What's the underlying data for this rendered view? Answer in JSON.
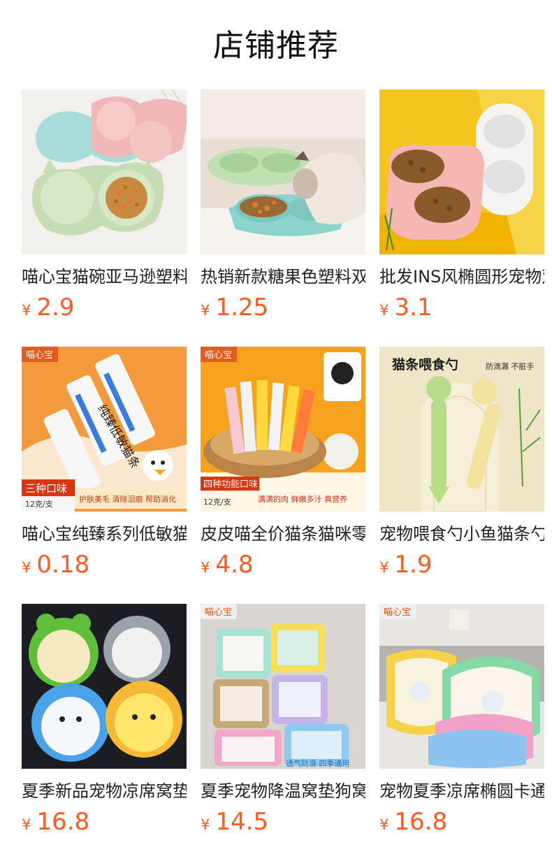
{
  "page": {
    "title": "店铺推荐"
  },
  "currency_symbol": "¥",
  "colors": {
    "price": "#ff5a1f",
    "text": "#222222"
  },
  "products": [
    {
      "name": "喵心宝猫碗亚马逊塑料双碗",
      "price": "2.9",
      "image": "cat-bowl-pastel-photo"
    },
    {
      "name": "热销新款糖果色塑料双碗",
      "price": "1.25",
      "image": "cat-eating-bowl-photo"
    },
    {
      "name": "批发INS风椭圆形宠物双碗",
      "price": "3.1",
      "image": "oval-double-bowl-photo"
    },
    {
      "name": "喵心宝纯臻系列低敏猫条",
      "price": "0.18",
      "image": "cat-treat-sticks-photo",
      "image_text": {
        "brand": "喵心宝",
        "product": "纯臻低敏猫条",
        "badge": "三种口味",
        "spec": "12克/支",
        "tagline": "护肤美毛 清除泪痕 帮助消化"
      }
    },
    {
      "name": "皮皮喵全价猫条猫咪零食",
      "price": "4.8",
      "image": "cat-treat-basket-photo",
      "image_text": {
        "brand": "喵心宝",
        "badge": "四种功能口味",
        "spec": "12克/支",
        "tagline": "满满的肉 鲜嫩多汁 真营养"
      }
    },
    {
      "name": "宠物喂食勺小鱼猫条勺",
      "price": "1.9",
      "image": "feeding-spoon-photo",
      "image_text": {
        "headline": "猫条喂食勺",
        "note": "防滴漏 不脏手"
      }
    },
    {
      "name": "夏季新品宠物凉席窝垫",
      "price": "16.8",
      "image": "animal-cooling-mats-photo"
    },
    {
      "name": "夏季宠物降温窝垫狗窝",
      "price": "14.5",
      "image": "square-cooling-beds-photo",
      "image_text": {
        "brand": "喵心宝",
        "tagline": "透气防滑 四季通用"
      }
    },
    {
      "name": "宠物夏季凉席椭圆卡通窝",
      "price": "16.8",
      "image": "oval-cooling-beds-photo",
      "image_text": {
        "brand": "喵心宝"
      }
    }
  ]
}
